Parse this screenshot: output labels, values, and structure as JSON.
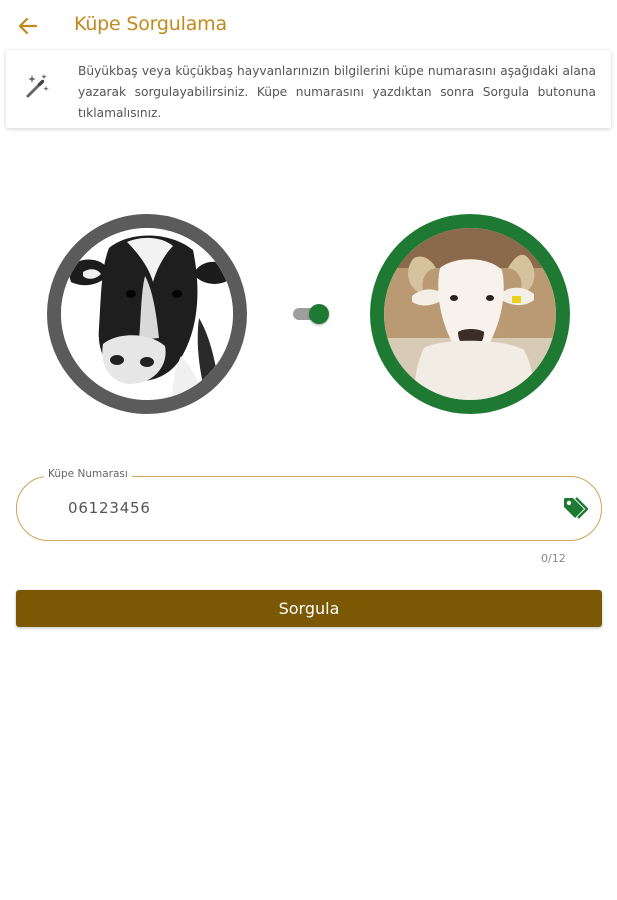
{
  "header": {
    "back_icon": "arrow-left-icon",
    "title": "Küpe Sorgulama"
  },
  "info": {
    "icon": "magic-wand-icon",
    "text": "Büyükbaş veya küçükbaş hayvanlarınızın bilgilerini küpe numarasını aşağıdaki alana yazarak sorgulayabilirsiniz. Küpe numarasını yazdıktan sonra Sorgula butonuna tıklamalısınız."
  },
  "animal_toggle": {
    "left_image": "cow-photo",
    "right_image": "sheep-photo",
    "selected": "right"
  },
  "ear_tag_field": {
    "label": "Küpe Numarası",
    "value": "06123456",
    "icon": "tags-icon",
    "counter": "0/12"
  },
  "query_button": {
    "label": "Sorgula"
  },
  "colors": {
    "accent": "#c08a1e",
    "button": "#7b5804",
    "green": "#1e7a32",
    "grey_ring": "#5b5b5b"
  }
}
